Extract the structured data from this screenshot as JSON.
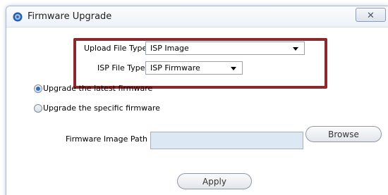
{
  "window": {
    "title": "Firmware Upgrade",
    "close_glyph": "☒",
    "icon": "gear-globe-icon"
  },
  "upload_file_type": {
    "label": "Upload File Type",
    "value": "ISP Image"
  },
  "isp_file_type": {
    "label": "ISP File Type",
    "value": "ISP Firmware"
  },
  "upgrade_options": [
    {
      "label": "Upgrade the latest firmware",
      "checked": true
    },
    {
      "label": "Upgrade the specific firmware",
      "checked": false
    }
  ],
  "firmware_path": {
    "label": "Firmware Image Path",
    "value": ""
  },
  "buttons": {
    "browse": "Browse",
    "apply": "Apply"
  },
  "colors": {
    "highlight_border": "#8b2a2e",
    "input_fill": "#dce8f3",
    "radio_checked": "#2f6fc7"
  }
}
